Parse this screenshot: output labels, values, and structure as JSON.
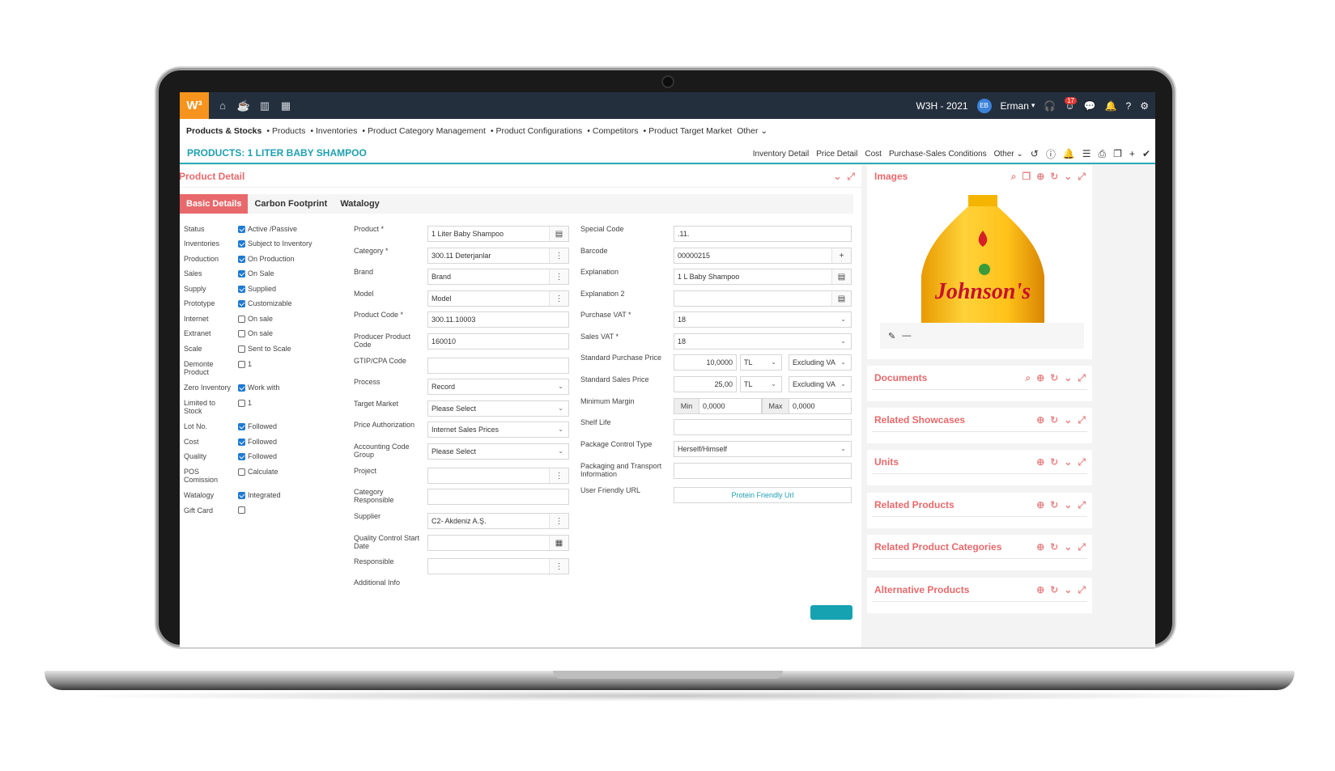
{
  "app": {
    "logo": "W³",
    "company": "W3H - 2021",
    "user_initials": "EB",
    "user_name": "Erman",
    "notif_count": "17"
  },
  "menu": {
    "items": [
      "Products & Stocks",
      "• Products",
      "• Inventories",
      "• Product Category Management",
      "• Product Configurations",
      "• Competitors",
      "• Product Target Market",
      "Other ⌄"
    ]
  },
  "page": {
    "title": "PRODUCTS: 1 LITER BABY SHAMPOO",
    "actions": [
      "Inventory Detail",
      "Price Detail",
      "Cost",
      "Purchase-Sales Conditions",
      "Other ⌄"
    ]
  },
  "detail": {
    "title": "Product Detail",
    "tabs": [
      "Basic Details",
      "Carbon Footprint",
      "Watalogy"
    ],
    "status_rows": [
      {
        "label": "Status",
        "value": "Active /Passive",
        "checked": true
      },
      {
        "label": "Inventories",
        "value": "Subject to Inventory",
        "checked": true
      },
      {
        "label": "Production",
        "value": "On Production",
        "checked": true
      },
      {
        "label": "Sales",
        "value": "On Sale",
        "checked": true
      },
      {
        "label": "Supply",
        "value": "Supplied",
        "checked": true
      },
      {
        "label": "Prototype",
        "value": "Customizable",
        "checked": true
      },
      {
        "label": "Internet",
        "value": "On sale",
        "checked": false
      },
      {
        "label": "Extranet",
        "value": "On sale",
        "checked": false
      },
      {
        "label": "Scale",
        "value": "Sent to Scale",
        "checked": false
      },
      {
        "label": "Demonte Product",
        "value": "1",
        "checked": false
      },
      {
        "label": "Zero Inventory",
        "value": "Work with",
        "checked": true
      },
      {
        "label": "Limited to Stock",
        "value": "1",
        "checked": false
      },
      {
        "label": "Lot No.",
        "value": "Followed",
        "checked": true
      },
      {
        "label": "Cost",
        "value": "Followed",
        "checked": true
      },
      {
        "label": "Quality",
        "value": "Followed",
        "checked": true
      },
      {
        "label": "POS Comission",
        "value": "Calculate",
        "checked": false
      },
      {
        "label": "Watalogy",
        "value": "Integrated",
        "checked": true
      },
      {
        "label": "Gift Card",
        "value": "",
        "checked": false
      }
    ],
    "mid_fields": [
      {
        "label": "Product *",
        "value": "1 Liter Baby Shampoo"
      },
      {
        "label": "Category *",
        "value": "300.11 Deterjanlar"
      },
      {
        "label": "Brand",
        "value": "Brand"
      },
      {
        "label": "Model",
        "value": "Model"
      },
      {
        "label": "Product Code *",
        "value": "300.11.10003"
      },
      {
        "label": "Producer Product Code",
        "value": "160010"
      },
      {
        "label": "GTIP/CPA Code",
        "value": ""
      },
      {
        "label": "Process",
        "value": "Record"
      },
      {
        "label": "Target Market",
        "value": "Please Select"
      },
      {
        "label": "Price Authorization",
        "value": "Internet Sales Prices"
      },
      {
        "label": "Accounting Code Group",
        "value": "Please Select"
      },
      {
        "label": "Project",
        "value": ""
      },
      {
        "label": "Category Responsible",
        "value": ""
      },
      {
        "label": "Supplier",
        "value": "C2- Akdeniz A.Ş."
      },
      {
        "label": "Quality Control Start Date",
        "value": ""
      },
      {
        "label": "Responsible",
        "value": ""
      },
      {
        "label": "Additional Info",
        "value": ""
      }
    ],
    "right_fields": [
      {
        "label": "Special Code",
        "value": ".11."
      },
      {
        "label": "Barcode",
        "value": "00000215"
      },
      {
        "label": "Explanation",
        "value": "1 L Baby Shampoo"
      },
      {
        "label": "Explanation 2",
        "value": ""
      },
      {
        "label": "Purchase VAT *",
        "value": "18"
      },
      {
        "label": "Sales VAT *",
        "value": "18"
      },
      {
        "label": "Standard Purchase Price",
        "value": "10,0000",
        "currency": "TL",
        "tax": "Excluding VA"
      },
      {
        "label": "Standard Sales Price",
        "value": "25,00",
        "currency": "TL",
        "tax": "Excluding VA"
      },
      {
        "label": "Minimum Margin",
        "min_label": "Min",
        "min": "0,0000",
        "max_label": "Max",
        "max": "0,0000"
      },
      {
        "label": "Shelf Life",
        "value": ""
      },
      {
        "label": "Package Control Type",
        "value": "Herself/Himself"
      },
      {
        "label": "Packaging and Transport Information",
        "value": ""
      },
      {
        "label": "User Friendly URL",
        "value": "Protein Friendly Url"
      }
    ]
  },
  "side": {
    "images_title": "Images",
    "product_brand_text": "Johnson's",
    "panels": [
      "Documents",
      "Related Showcases",
      "Units",
      "Related Products",
      "Related Product Categories",
      "Alternative Products"
    ]
  },
  "colors": {
    "accent": "#e8696b",
    "teal": "#1e9fb0",
    "topbar": "#242f3e",
    "logo": "#f7941d"
  }
}
